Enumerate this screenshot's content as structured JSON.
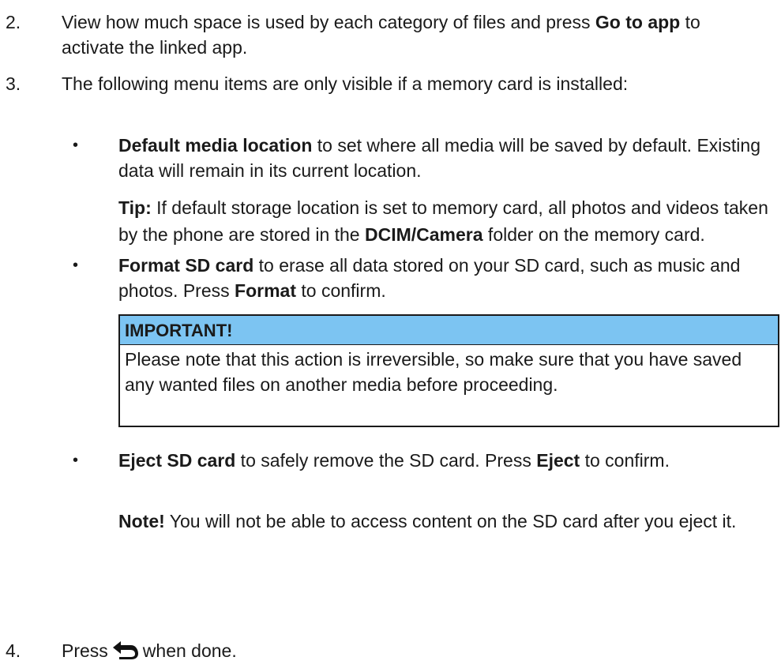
{
  "steps": {
    "s2": {
      "number": "2.",
      "pre": "View how much space is used by each category of files and press ",
      "bold": "Go to app",
      "post": " to activate the linked app."
    },
    "s3": {
      "number": "3.",
      "text": "The following menu items are only visible if a memory card is installed:"
    },
    "s4": {
      "number": "4.",
      "pre": "Press",
      "post": "when done.",
      "icon": "back-icon"
    }
  },
  "bullets": {
    "default_media": {
      "symbol": "•",
      "bold": "Default media location",
      "text": " to set where all media will be saved by default. Existing data will remain in its current location."
    },
    "tip": {
      "label": "Tip:",
      "pre": " If default storage location is set to memory card, all photos and videos taken by the phone are stored in the ",
      "bold": "DCIM/Camera",
      "post": " folder on the memory card."
    },
    "format_sd": {
      "symbol": "•",
      "bold": "Format SD card",
      "pre": " to erase all data stored on your SD card, such as music and photos. Press ",
      "bold2": "Format",
      "post": " to confirm."
    },
    "eject_sd": {
      "symbol": "•",
      "bold": "Eject SD card",
      "pre": " to safely remove the SD card. Press ",
      "bold2": "Eject",
      "post": " to confirm."
    },
    "note": {
      "label": "Note!",
      "text": " You will not be able to access content on the SD card after you eject it."
    }
  },
  "important": {
    "title": "IMPORTANT!",
    "text": "Please note that this action is irreversible, so make sure that you have saved any wanted files on another media before proceeding.",
    "header_color": "#7cc4f2"
  }
}
